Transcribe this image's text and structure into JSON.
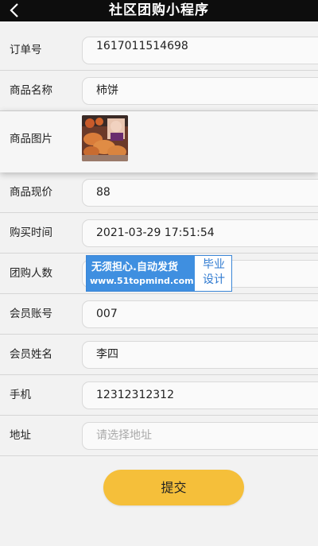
{
  "header": {
    "title": "社区团购小程序"
  },
  "form": {
    "order_no": {
      "label": "订单号",
      "value": "1617011514698"
    },
    "product_name": {
      "label": "商品名称",
      "value": "柿饼"
    },
    "product_image": {
      "label": "商品图片"
    },
    "price": {
      "label": "商品现价",
      "value": "88"
    },
    "purchase_time": {
      "label": "购买时间",
      "value": "2021-03-29 17:51:54"
    },
    "group_count": {
      "label": "团购人数",
      "value": ""
    },
    "member_account": {
      "label": "会员账号",
      "value": "007"
    },
    "member_name": {
      "label": "会员姓名",
      "value": "李四"
    },
    "phone": {
      "label": "手机",
      "value": "12312312312"
    },
    "address": {
      "label": "地址",
      "placeholder": "请选择地址"
    }
  },
  "submit_label": "提交",
  "watermark": {
    "line1": "无须担心.自动发货",
    "line2": "www.51topmind.com",
    "right1": "毕业",
    "right2": "设计"
  },
  "colors": {
    "header_bg": "#0d0d0d",
    "submit_bg": "#f5bf3a",
    "watermark_blue": "#3f8fe0"
  },
  "icons": {
    "back": "chevron-left-icon"
  }
}
